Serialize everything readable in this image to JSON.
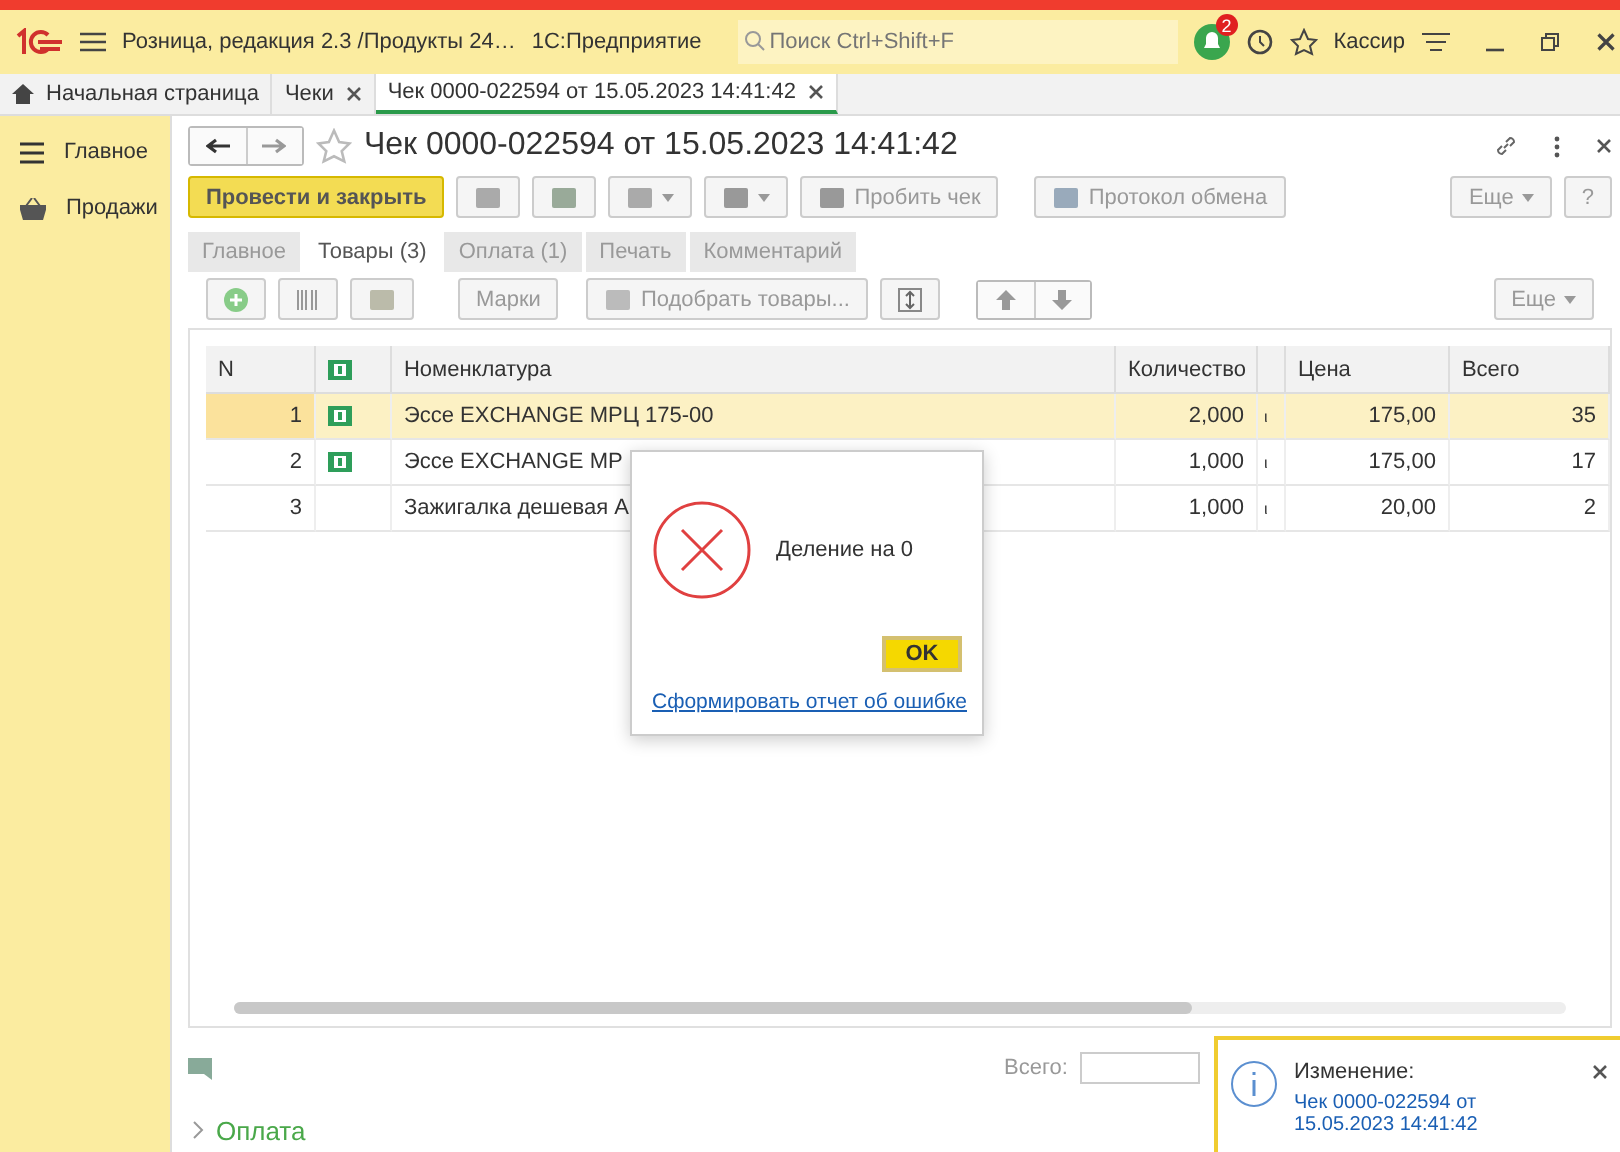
{
  "app": {
    "title": "Розница, редакция 2.3 /Продукты  24…",
    "platform": "1С:Предприятие",
    "search_placeholder": "Поиск Ctrl+Shift+F",
    "notifications": "2",
    "user": "Кассир"
  },
  "open_tabs": [
    {
      "label": "Начальная страница",
      "kind": "home",
      "selected": false
    },
    {
      "label": "Чеки",
      "kind": "closable",
      "selected": false
    },
    {
      "label": "Чек 0000-022594 от 15.05.2023 14:41:42",
      "kind": "closable",
      "selected": true
    }
  ],
  "sidebar": {
    "items": [
      {
        "label": "Главное",
        "kind": "menu"
      },
      {
        "label": "Продажи",
        "kind": "basket"
      }
    ]
  },
  "document": {
    "title": "Чек 0000-022594 от 15.05.2023 14:41:42",
    "toolbar": {
      "primary": "Провести и закрыть",
      "print_receipt": "Пробить чек",
      "exchange_log": "Протокол обмена",
      "more": "Еще",
      "help": "?"
    },
    "tabs": [
      {
        "label": "Главное",
        "selected": false
      },
      {
        "label": "Товары (3)",
        "selected": true
      },
      {
        "label": "Оплата (1)",
        "selected": false
      },
      {
        "label": "Печать",
        "selected": false
      },
      {
        "label": "Комментарий",
        "selected": false
      }
    ],
    "table_toolbar": {
      "marks": "Марки",
      "pick": "Подобрать товары...",
      "more": "Еще"
    },
    "table": {
      "columns": [
        "N",
        "",
        "Номенклатура",
        "Количество",
        "",
        "Цена",
        "Всего"
      ],
      "rows": [
        {
          "n": "1",
          "marked": true,
          "item": "Эссе EXCHANGE  МРЦ 175-00",
          "qty": "2,000",
          "unit": "ι",
          "price": "175,00",
          "total": "35",
          "selected": true
        },
        {
          "n": "2",
          "marked": true,
          "item": "Эссе EXCHANGE  МР",
          "qty": "1,000",
          "unit": "ι",
          "price": "175,00",
          "total": "17",
          "selected": false
        },
        {
          "n": "3",
          "marked": false,
          "item": "Зажигалка дешевая А",
          "qty": "1,000",
          "unit": "ι",
          "price": "20,00",
          "total": "2",
          "selected": false
        }
      ]
    },
    "total_label": "Всего:",
    "payment_section": "Оплата"
  },
  "error_dialog": {
    "message": "Деление на 0",
    "ok": "OK",
    "report_link": "Сформировать отчет об ошибке"
  },
  "notification": {
    "title": "Изменение:",
    "link": "Чек 0000-022594 от 15.05.2023 14:41:42"
  }
}
